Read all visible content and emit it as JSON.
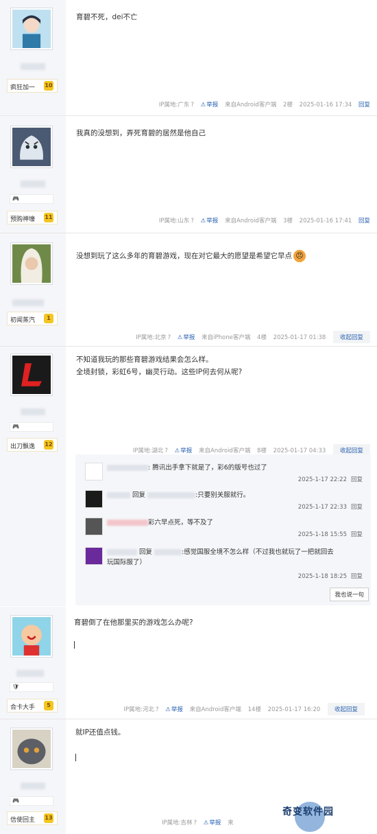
{
  "posts": [
    {
      "rank_title": "疯狂加一",
      "rank_level": "10",
      "content": "育碧不死，dei不亡",
      "ip": "IP属地:广东",
      "report": "举报",
      "client": "来自Android客户端",
      "floor": "2楼",
      "time": "2025-01-16 17:34",
      "action": "回复"
    },
    {
      "rank_title": "预购神壕",
      "rank_level": "11",
      "content": "我真的没想到，弄死育碧的居然是他自己",
      "ip": "IP属地:山东",
      "report": "举报",
      "client": "来自Android客户端",
      "floor": "3楼",
      "time": "2025-01-16 17:41",
      "action": "回复"
    },
    {
      "rank_title": "初闻蒸汽",
      "rank_level": "1",
      "content": "没想到玩了这么多年的育碧游戏，现在对它最大的愿望是希望它早点",
      "ip": "IP属地:北京",
      "report": "举报",
      "client": "来自iPhone客户端",
      "floor": "4楼",
      "time": "2025-01-17 01:38",
      "action": "收起回复"
    },
    {
      "rank_title": "出刀飘逸",
      "rank_level": "12",
      "content_lines": [
        "不知道我玩的那些育碧游戏结果会怎么样。",
        "全境封锁，彩虹6号，幽灵行动。这些IP何去何从呢?"
      ],
      "ip": "IP属地:湖北",
      "report": "举报",
      "client": "来自Android客户端",
      "floor": "8楼",
      "time": "2025-01-17 04:33",
      "action": "收起回复"
    },
    {
      "rank_title": "合卡大手",
      "rank_level": "5",
      "content": "育碧倒了在他那里买的游戏怎么办呢?",
      "ip": "IP属地:河北",
      "report": "举报",
      "client": "来自Android客户端",
      "floor": "14楼",
      "time": "2025-01-17 16:20",
      "action": "收起回复"
    },
    {
      "rank_title": "信使回主",
      "rank_level": "13",
      "content": "就IP还值点钱。",
      "ip": "IP属地:吉林",
      "report": "举报",
      "client": "来"
    }
  ],
  "sub_replies": [
    {
      "text": ": 腾讯出手拿下就是了，彩6的版号也过了",
      "time": "2025-1-17 22:22",
      "action": "回复"
    },
    {
      "reply_word": "回复",
      "text": ":只要别关服就行。",
      "time": "2025-1-17 22:33",
      "action": "回复"
    },
    {
      "text": "彩六早点死，等不及了",
      "time": "2025-1-18 15:55",
      "action": "回复"
    },
    {
      "reply_word": "回复",
      "text_line1": ":感觉国服全境不怎么样（不过我也就玩了一把就回去",
      "text_line2": "玩国际服了）",
      "time": "2025-1-18 18:25",
      "action": "回复"
    }
  ],
  "say_button": "我也说一句",
  "watermark": "奇变软件园",
  "icons": {
    "ip_help": "question-circle-icon",
    "report": "warning-triangle-icon",
    "emoji": "angry-face-icon"
  }
}
